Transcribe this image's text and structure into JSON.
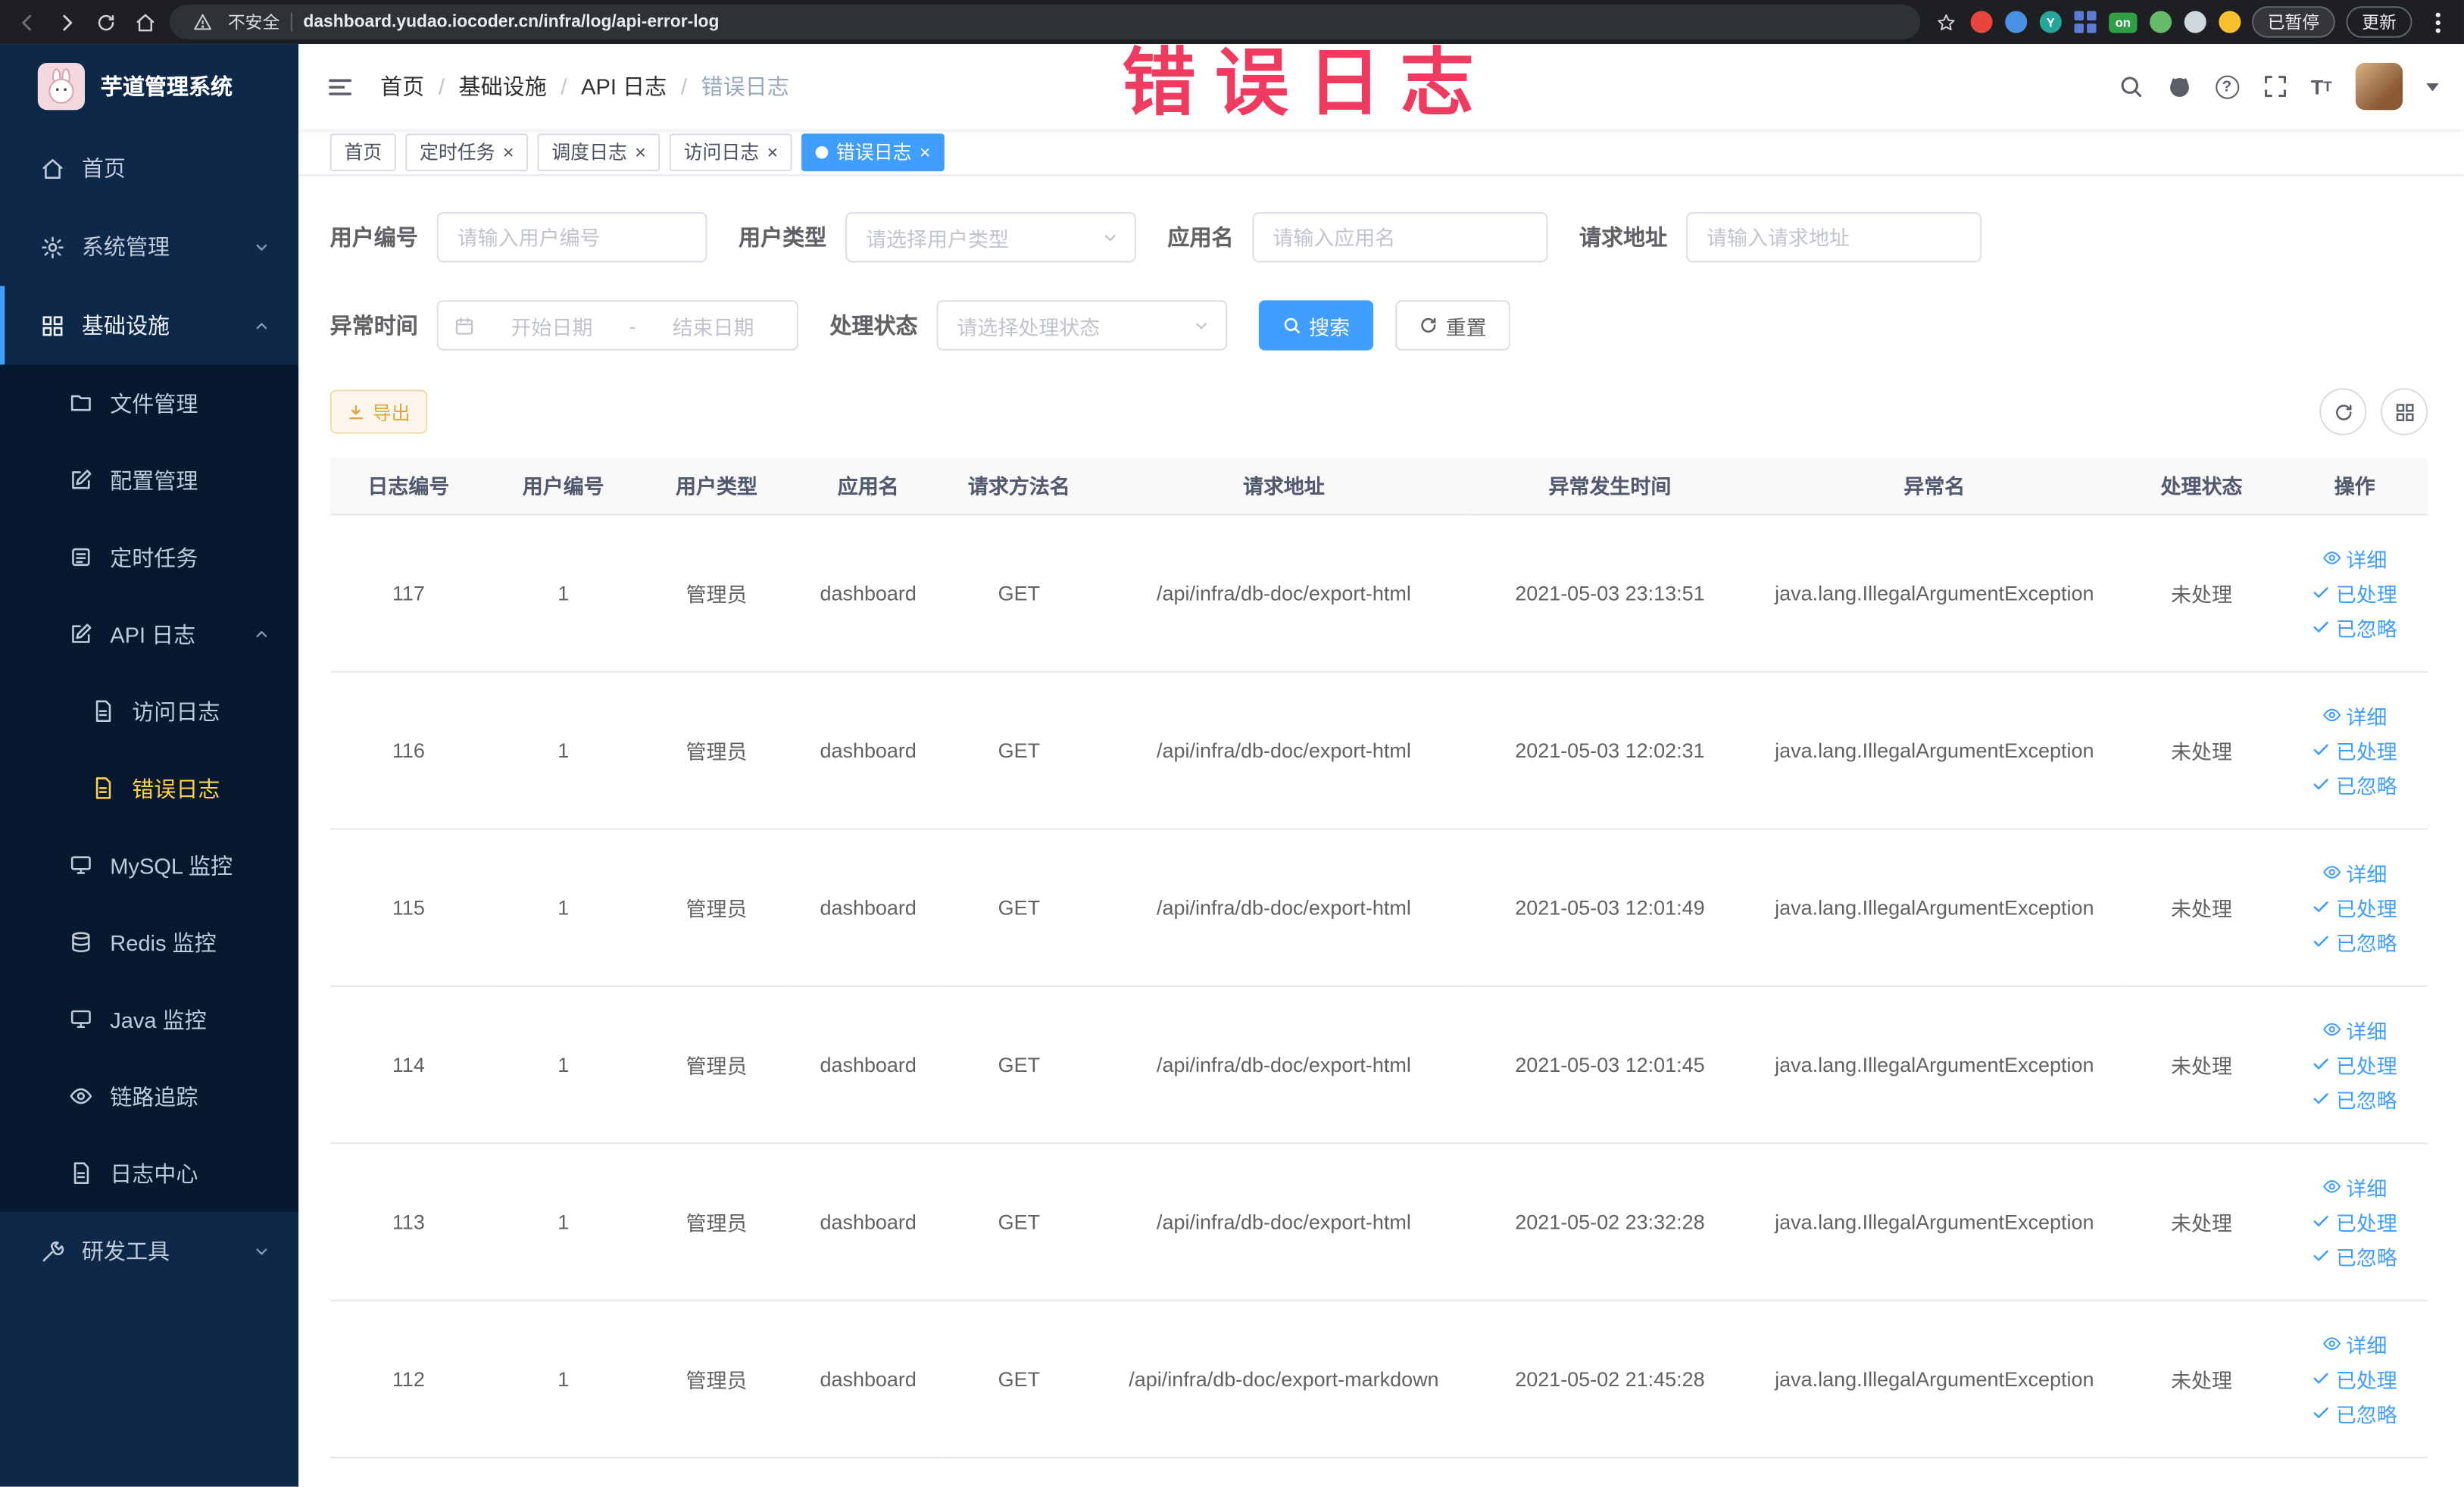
{
  "browser": {
    "security_label": "不安全",
    "url": "dashboard.yudao.iocoder.cn/infra/log/api-error-log",
    "paused_button": "已暂停",
    "update_button": "更新",
    "on_badge": "on",
    "y_badge": "Y"
  },
  "overlay": {
    "watermark": "错误日志"
  },
  "sidebar": {
    "logo_title": "芋道管理系统",
    "items": [
      {
        "label": "首页"
      },
      {
        "label": "系统管理"
      },
      {
        "label": "基础设施"
      },
      {
        "label": "文件管理"
      },
      {
        "label": "配置管理"
      },
      {
        "label": "定时任务"
      },
      {
        "label": "API 日志"
      },
      {
        "label": "访问日志"
      },
      {
        "label": "错误日志"
      },
      {
        "label": "MySQL 监控"
      },
      {
        "label": "Redis 监控"
      },
      {
        "label": "Java 监控"
      },
      {
        "label": "链路追踪"
      },
      {
        "label": "日志中心"
      },
      {
        "label": "研发工具"
      }
    ]
  },
  "header": {
    "breadcrumb": [
      "首页",
      "基础设施",
      "API 日志",
      "错误日志"
    ]
  },
  "tabs": [
    {
      "label": "首页",
      "closable": false,
      "active": false
    },
    {
      "label": "定时任务",
      "closable": true,
      "active": false
    },
    {
      "label": "调度日志",
      "closable": true,
      "active": false
    },
    {
      "label": "访问日志",
      "closable": true,
      "active": false
    },
    {
      "label": "错误日志",
      "closable": true,
      "active": true
    }
  ],
  "filters": {
    "user_id": {
      "label": "用户编号",
      "placeholder": "请输入用户编号"
    },
    "user_type": {
      "label": "用户类型",
      "placeholder": "请选择用户类型"
    },
    "app_name": {
      "label": "应用名",
      "placeholder": "请输入应用名"
    },
    "request_url": {
      "label": "请求地址",
      "placeholder": "请输入请求地址"
    },
    "exception_time": {
      "label": "异常时间",
      "start_placeholder": "开始日期",
      "separator": "-",
      "end_placeholder": "结束日期"
    },
    "process_status": {
      "label": "处理状态",
      "placeholder": "请选择处理状态"
    },
    "search_button": "搜索",
    "reset_button": "重置"
  },
  "toolbar": {
    "export_button": "导出"
  },
  "table": {
    "columns": [
      "日志编号",
      "用户编号",
      "用户类型",
      "应用名",
      "请求方法名",
      "请求地址",
      "异常发生时间",
      "异常名",
      "处理状态",
      "操作"
    ],
    "actions": [
      "详细",
      "已处理",
      "已忽略"
    ],
    "rows": [
      {
        "id": "117",
        "user_id": "1",
        "user_type": "管理员",
        "app": "dashboard",
        "method": "GET",
        "url": "/api/infra/db-doc/export-html",
        "time": "2021-05-03 23:13:51",
        "exception": "java.lang.IllegalArgumentException",
        "status": "未处理"
      },
      {
        "id": "116",
        "user_id": "1",
        "user_type": "管理员",
        "app": "dashboard",
        "method": "GET",
        "url": "/api/infra/db-doc/export-html",
        "time": "2021-05-03 12:02:31",
        "exception": "java.lang.IllegalArgumentException",
        "status": "未处理"
      },
      {
        "id": "115",
        "user_id": "1",
        "user_type": "管理员",
        "app": "dashboard",
        "method": "GET",
        "url": "/api/infra/db-doc/export-html",
        "time": "2021-05-03 12:01:49",
        "exception": "java.lang.IllegalArgumentException",
        "status": "未处理"
      },
      {
        "id": "114",
        "user_id": "1",
        "user_type": "管理员",
        "app": "dashboard",
        "method": "GET",
        "url": "/api/infra/db-doc/export-html",
        "time": "2021-05-03 12:01:45",
        "exception": "java.lang.IllegalArgumentException",
        "status": "未处理"
      },
      {
        "id": "113",
        "user_id": "1",
        "user_type": "管理员",
        "app": "dashboard",
        "method": "GET",
        "url": "/api/infra/db-doc/export-html",
        "time": "2021-05-02 23:32:28",
        "exception": "java.lang.IllegalArgumentException",
        "status": "未处理"
      },
      {
        "id": "112",
        "user_id": "1",
        "user_type": "管理员",
        "app": "dashboard",
        "method": "GET",
        "url": "/api/infra/db-doc/export-markdown",
        "time": "2021-05-02 21:45:28",
        "exception": "java.lang.IllegalArgumentException",
        "status": "未处理"
      }
    ]
  },
  "colors": {
    "accent": "#409eff",
    "sidebar_bg": "#0d2848",
    "sidebar_submenu_bg": "#07192f",
    "sidebar_active_text": "#ffd04b",
    "warning_text": "#e6a23c",
    "watermark": "#ef3b5f"
  }
}
